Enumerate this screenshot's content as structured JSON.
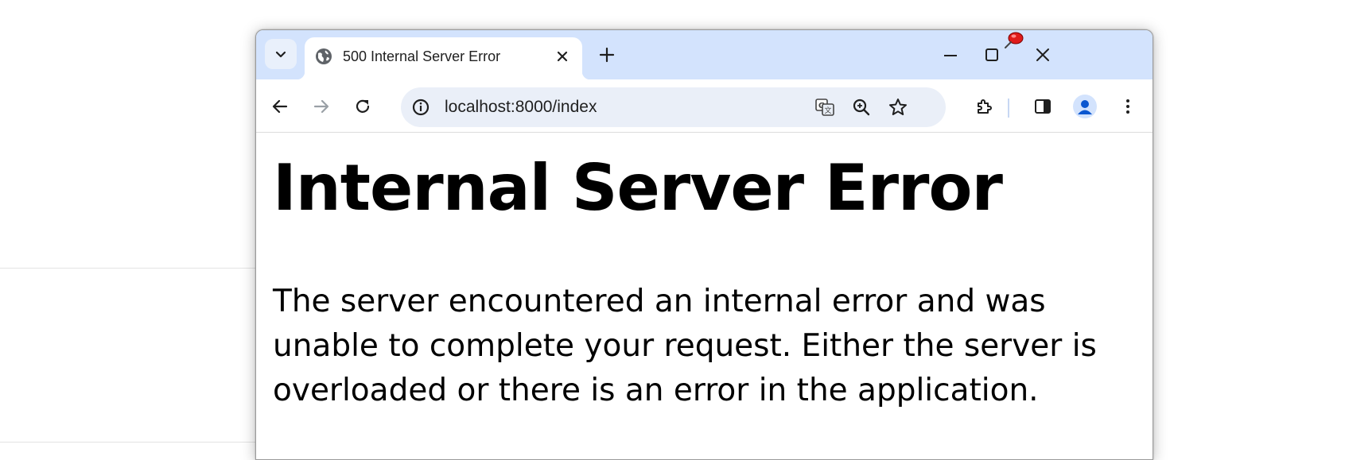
{
  "browser": {
    "tab": {
      "title": "500 Internal Server Error",
      "favicon": "globe-icon"
    },
    "tab_search_icon": "chevron-down-icon",
    "new_tab_icon": "plus-icon",
    "window_controls": [
      "minimize-icon",
      "maximize-icon",
      "close-icon"
    ],
    "overlay_icon": "pushpin-icon",
    "nav": {
      "back_icon": "arrow-left-icon",
      "forward_icon": "arrow-right-icon",
      "reload_icon": "reload-icon"
    },
    "omnibox": {
      "url": "localhost:8000/index",
      "site_info_icon": "info-icon",
      "actions": [
        "translate-icon",
        "zoom-icon",
        "star-icon"
      ]
    },
    "toolbar_actions": [
      "extensions-icon",
      "side-panel-icon",
      "profile-icon",
      "more-icon"
    ]
  },
  "page": {
    "heading": "Internal Server Error",
    "message": "The server encountered an internal error and was unable to complete your request. Either the server is overloaded or there is an error in the application."
  },
  "colors": {
    "titlebar": "#d3e3fd",
    "omnibox": "#eaeff8",
    "profile": "#0b57d0"
  }
}
